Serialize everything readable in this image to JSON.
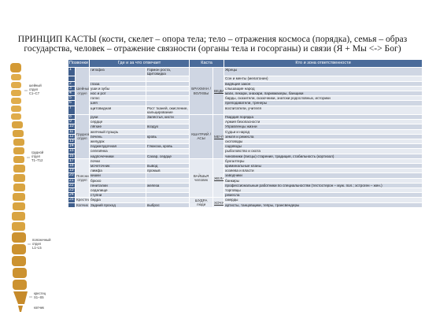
{
  "title": "ПРИНЦИП КАСТЫ (кости, скелет – опора тела; тело – отражения космоса (порядка), семья – образ государства, человек – отражение связности (органы тела и госорганы) и связи (Я + Мы <-> Бог)",
  "spine_labels": [
    {
      "text": "шейный\nотдел\nС1–С7"
    },
    {
      "text": "грудной\nотдел\nТ1–Т12"
    },
    {
      "text": "поясничный\nотдел\nL1–L5"
    },
    {
      "text": "крестец\nS1–S5"
    },
    {
      "text": "копчик"
    }
  ],
  "headers": [
    "Позвонки",
    "Где и за что отвечает",
    "Каста",
    "Кто и зона ответственности"
  ],
  "sections": {
    "cervical": "Шейный отдел",
    "thoracic": "Грудной отдел",
    "lumbar": "Поясничный отдел",
    "sacrum": "Крестец",
    "coccyx": "Копчик"
  },
  "castes": {
    "brahmins": "БРАХМАН / ВОЛХВЫ",
    "kshatriya": "КШАТРИЙ / АСЫ",
    "vaishya": "ВАЙШЬЯ человек",
    "shudra": "ШУДРА люди"
  },
  "subcastes": {
    "b1": "ВЕДИСТВИЕ",
    "k1": "МЕЧТА",
    "v1": "ЖЕЛАНИЯ",
    "s1": "ХОЧУ"
  },
  "rows": [
    {
      "n": "1",
      "organ": "гипофиз",
      "func": "Гормон роста, Щитовидка",
      "who": "Жрецы"
    },
    {
      "n": "",
      "organ": "",
      "func": "",
      "who": "Сон и менты (мелатонин)"
    },
    {
      "n": "2",
      "organ": "глаза",
      "func": "",
      "who": "видящие закон"
    },
    {
      "n": "3",
      "organ": "уши и зубы",
      "func": "",
      "who": "слышащие народ"
    },
    {
      "n": "4",
      "organ": "нос и рот",
      "func": "",
      "who": "маги, лекари, знахари, парикмахеры, банщики"
    },
    {
      "n": "5",
      "organ": "голос",
      "func": "",
      "who": "барды, сказители, сказочники, знатоки родословных, историки"
    },
    {
      "n": "6",
      "organ": "шея",
      "func": "",
      "who": "преподаватели, тренеры"
    },
    {
      "n": "7",
      "organ": "щитовидная",
      "func": "Рост тканей, окисление, кальцирование",
      "who": "воспитатели, учителя"
    },
    {
      "n": "8",
      "organ": "руки",
      "func": "Запястья, кисти",
      "who": "Гвардия порядка"
    },
    {
      "n": "9",
      "organ": "сердце",
      "func": "",
      "who": "Армия безопасности"
    },
    {
      "n": "10",
      "organ": "лёгкие",
      "func": "воздух",
      "who": "Управленцы жизни"
    },
    {
      "n": "11",
      "organ": "желчный пузырь",
      "func": "",
      "who": "Судьи и народ"
    },
    {
      "n": "12",
      "organ": "печень",
      "func": "кровь",
      "who": "земля и ремесла"
    },
    {
      "n": "13",
      "organ": "желудок",
      "func": "",
      "who": "скотоводы"
    },
    {
      "n": "14",
      "organ": "поджелудочная",
      "func": "Глюкоза, кровь",
      "who": "садоводы"
    },
    {
      "n": "15",
      "organ": "селезёнка",
      "func": "",
      "who": "рыболовство и охота"
    },
    {
      "n": "16",
      "organ": "надпочечники",
      "func": "Сахар, сердце",
      "who": "чиновники (писцы) старение, традиция, стабильность (кортизол)"
    },
    {
      "n": "17",
      "organ": "почки",
      "func": "",
      "who": "бухгалтеры"
    },
    {
      "n": "18",
      "organ": "мочеточник",
      "func": "вывод",
      "who": "криминальные кланы"
    },
    {
      "n": "19",
      "organ": "лимфа",
      "func": "промыв",
      "who": "хозяева и власти"
    },
    {
      "n": "20",
      "organ": "кишки",
      "func": "",
      "who": "заводчики"
    },
    {
      "n": "21",
      "organ": "брюхо",
      "func": "",
      "who": "банкиры"
    },
    {
      "n": "22",
      "organ": "гениталии",
      "func": "железа",
      "who": "профессиональные работники по специальностям (тестостерон – муж. пол.; эстроген – жен.)"
    },
    {
      "n": "23",
      "organ": "седалище",
      "func": "",
      "who": "торговцы"
    },
    {
      "n": "24",
      "organ": "ступни",
      "func": "",
      "who": "ремесла"
    },
    {
      "n": "25",
      "organ": "бедра",
      "func": "",
      "who": "смерды"
    },
    {
      "n": "",
      "organ": "Задний проход",
      "func": "выброс",
      "who": "артисты, танцовщики, тепры, трансвендеры"
    }
  ],
  "colors": {
    "header": "#4a6b9a",
    "num": "#3f5e8c",
    "row_a": "#cfd6e3",
    "row_b": "#e6eaf1",
    "bone": "#d9a441"
  }
}
